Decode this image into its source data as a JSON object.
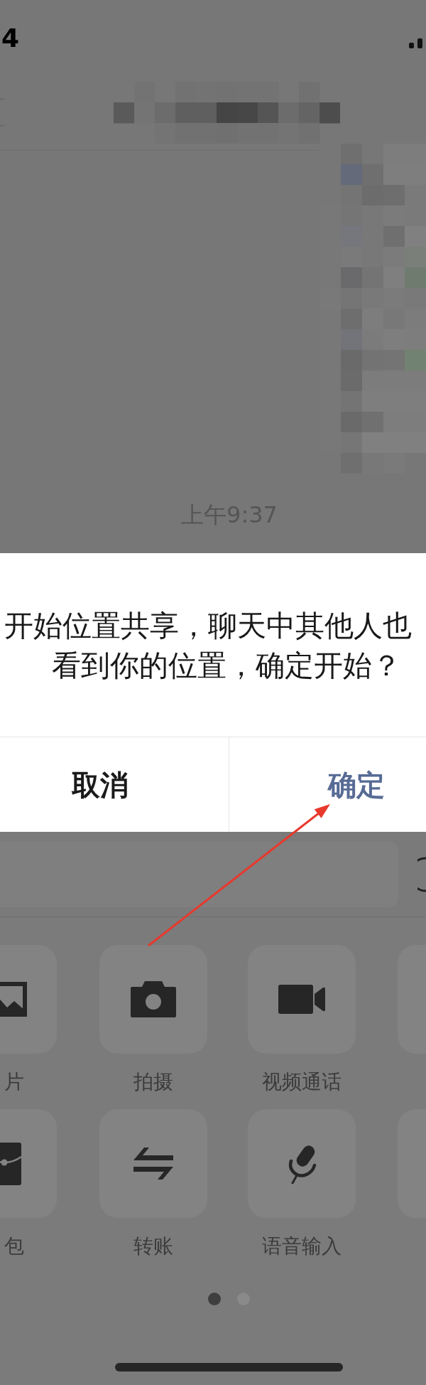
{
  "status_bar": {
    "time": "4"
  },
  "chat": {
    "timestamp": "上午9:37"
  },
  "dialog": {
    "message": [
      "开始位置共享，聊天中其他人也",
      "看到你的位置，确定开始？"
    ],
    "buttons": [
      {
        "label": "取消",
        "kind": "cancel"
      },
      {
        "label": "确定",
        "kind": "confirm"
      }
    ]
  },
  "panel": {
    "items": [
      {
        "label": "片"
      },
      {
        "label": "拍摄"
      },
      {
        "label": "视频通话"
      },
      {
        "label": "包"
      },
      {
        "label": "转账"
      },
      {
        "label": "语音输入"
      }
    ],
    "pages": [
      {
        "selected": true
      },
      {
        "selected": false
      }
    ]
  }
}
